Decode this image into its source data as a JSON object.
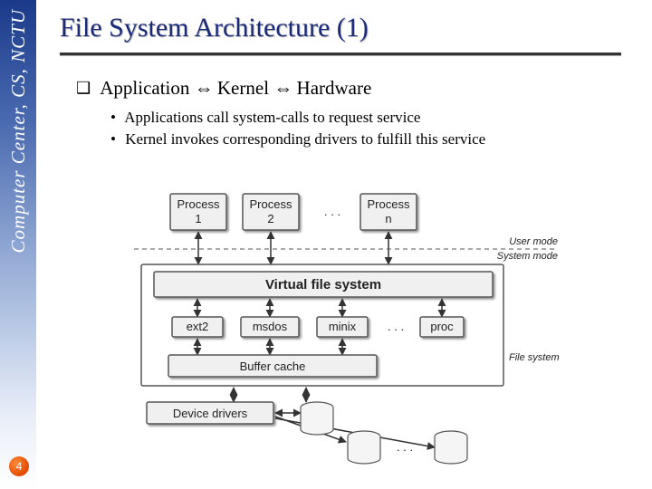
{
  "sidebar": {
    "org": "Computer Center, CS, NCTU"
  },
  "page": {
    "number": "4"
  },
  "title": "File System Architecture (1)",
  "main_bullet": {
    "prefix_glyph": "❑",
    "p1": "Application",
    "arrow": "⇔",
    "p2": "Kernel",
    "p3": "Hardware"
  },
  "subs": [
    "Applications call system-calls to request service",
    "Kernel invokes corresponding drivers to fulfill this service"
  ],
  "diagram": {
    "processes": [
      "Process",
      "Process",
      "Process"
    ],
    "process_nums": [
      "1",
      "2",
      "n"
    ],
    "dots": ". . .",
    "user_mode": "User mode",
    "system_mode": "System mode",
    "vfs": "Virtual file system",
    "fs_types": [
      "ext2",
      "msdos",
      "minix",
      "proc"
    ],
    "buffer": "Buffer cache",
    "fs_label": "File system",
    "drivers": "Device drivers"
  }
}
